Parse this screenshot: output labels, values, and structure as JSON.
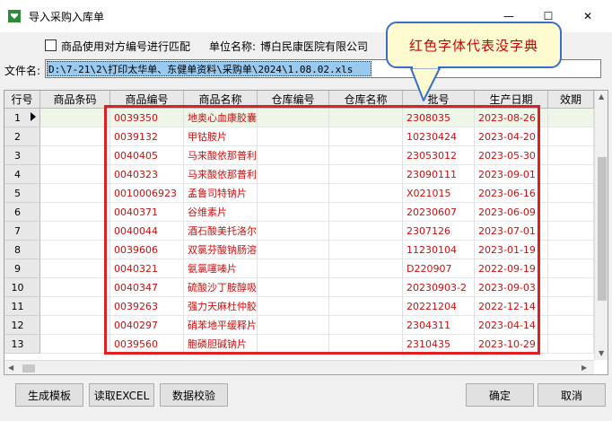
{
  "window": {
    "title": "导入采购入库单",
    "controls": {
      "minimize": "—",
      "maximize": "☐",
      "close": "✕"
    }
  },
  "options": {
    "match_label": "商品使用对方编号进行匹配",
    "match_checked": false,
    "unit_label": "单位名称:",
    "unit_value": "博白民康医院有限公司"
  },
  "file": {
    "label": "文件名:",
    "value": "D:\\7-21\\2\\打印太华单、东健单资料\\采购单\\2024\\1.08.02.xls"
  },
  "callout": {
    "text": "红色字体代表没字典"
  },
  "grid": {
    "columns": [
      "行号",
      "商品条码",
      "商品编号",
      "商品名称",
      "仓库编号",
      "仓库名称",
      "批号",
      "生产日期",
      "效期"
    ],
    "rows": [
      {
        "no": "1",
        "barcode": "",
        "code": "0039350",
        "name": "地奥心血康胶囊",
        "wh_code": "",
        "wh_name": "",
        "batch": "2308035",
        "date": "2023-08-26"
      },
      {
        "no": "2",
        "barcode": "",
        "code": "0039132",
        "name": "甲钴胺片",
        "wh_code": "",
        "wh_name": "",
        "batch": "10230424",
        "date": "2023-04-20"
      },
      {
        "no": "3",
        "barcode": "",
        "code": "0040405",
        "name": "马来酸依那普利",
        "wh_code": "",
        "wh_name": "",
        "batch": "23053012",
        "date": "2023-05-30"
      },
      {
        "no": "4",
        "barcode": "",
        "code": "0040323",
        "name": "马来酸依那普利",
        "wh_code": "",
        "wh_name": "",
        "batch": "23090111",
        "date": "2023-09-01"
      },
      {
        "no": "5",
        "barcode": "",
        "code": "0010006923",
        "name": "孟鲁司特钠片",
        "wh_code": "",
        "wh_name": "",
        "batch": "X021015",
        "date": "2023-06-16"
      },
      {
        "no": "6",
        "barcode": "",
        "code": "0040371",
        "name": "谷维素片",
        "wh_code": "",
        "wh_name": "",
        "batch": "20230607",
        "date": "2023-06-09"
      },
      {
        "no": "7",
        "barcode": "",
        "code": "0040044",
        "name": "酒石酸美托洛尔",
        "wh_code": "",
        "wh_name": "",
        "batch": "2307126",
        "date": "2023-07-01"
      },
      {
        "no": "8",
        "barcode": "",
        "code": "0039606",
        "name": "双氯芬酸钠肠溶",
        "wh_code": "",
        "wh_name": "",
        "batch": "11230104",
        "date": "2023-01-19"
      },
      {
        "no": "9",
        "barcode": "",
        "code": "0040321",
        "name": "氨氯噻嗪片",
        "wh_code": "",
        "wh_name": "",
        "batch": "D220907",
        "date": "2022-09-19"
      },
      {
        "no": "10",
        "barcode": "",
        "code": "0040347",
        "name": "硫酸沙丁胺醇吸",
        "wh_code": "",
        "wh_name": "",
        "batch": "20230903-2",
        "date": "2023-09-03"
      },
      {
        "no": "11",
        "barcode": "",
        "code": "0039263",
        "name": "强力天麻杜仲胶",
        "wh_code": "",
        "wh_name": "",
        "batch": "20221204",
        "date": "2022-12-14"
      },
      {
        "no": "12",
        "barcode": "",
        "code": "0040297",
        "name": "硝苯地平缓释片",
        "wh_code": "",
        "wh_name": "",
        "batch": "2304311",
        "date": "2023-04-14"
      },
      {
        "no": "13",
        "barcode": "",
        "code": "0039560",
        "name": "胞磷胆碱钠片",
        "wh_code": "",
        "wh_name": "",
        "batch": "2310435",
        "date": "2023-10-29"
      }
    ]
  },
  "buttons": {
    "generate_template": "生成模板",
    "read_excel": "读取EXCEL",
    "validate": "数据校验",
    "ok": "确定",
    "cancel": "取消"
  },
  "colors": {
    "missing_dictionary_text": "#cc1010",
    "highlight_box": "#e02020",
    "callout_border": "#3a6fc7",
    "callout_background": "#fffbd0",
    "selection": "#99c9ef"
  }
}
